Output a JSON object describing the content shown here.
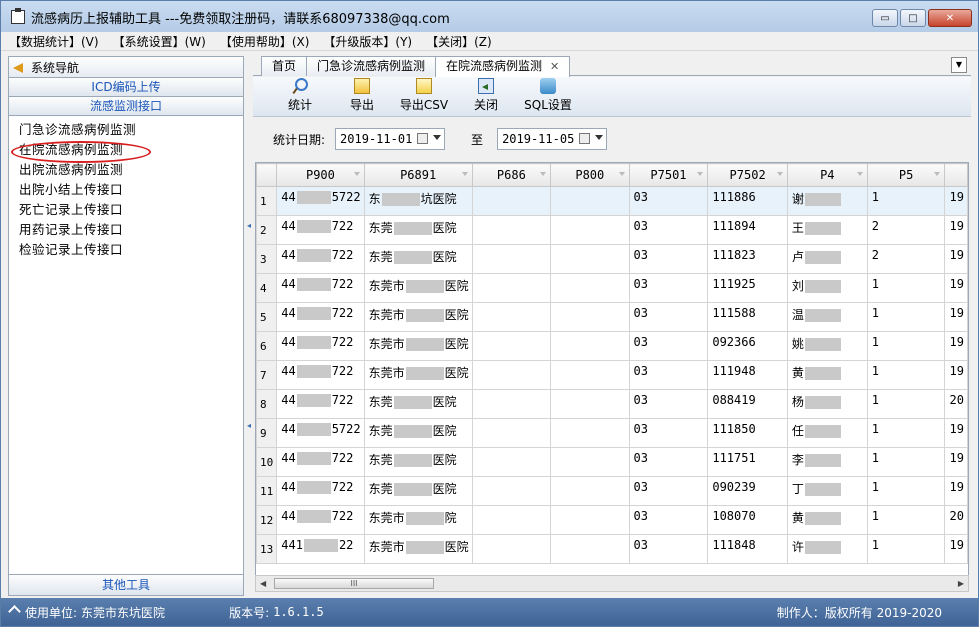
{
  "window": {
    "title": "流感病历上报辅助工具 ---免费领取注册码，请联系68097338@qq.com",
    "buttons": {
      "minimize": "▭",
      "maximize": "□",
      "close": "✕"
    }
  },
  "menu": [
    "【数据统计】(V)",
    "【系统设置】(W)",
    "【使用帮助】(X)",
    "【升级版本】(Y)",
    "【关闭】(Z)"
  ],
  "sidebar": {
    "header": "系统导航",
    "tabs": [
      "ICD编码上传",
      "流感监测接口"
    ],
    "items": [
      "门急诊流感病例监测",
      "在院流感病例监测",
      "出院流感病例监测",
      "出院小结上传接口",
      "死亡记录上传接口",
      "用药记录上传接口",
      "检验记录上传接口"
    ],
    "bottom_tab": "其他工具",
    "highlighted_item": "在院流感病例监测"
  },
  "tabs": [
    {
      "label": "首页"
    },
    {
      "label": "门急诊流感病例监测"
    },
    {
      "label": "在院流感病例监测",
      "close": "✕",
      "active": true
    }
  ],
  "toolbar": [
    {
      "label": "统计",
      "icon": "search-icon"
    },
    {
      "label": "导出",
      "icon": "export-icon"
    },
    {
      "label": "导出CSV",
      "icon": "export-csv-icon"
    },
    {
      "label": "关闭",
      "icon": "exit-icon"
    },
    {
      "label": "SQL设置",
      "icon": "sql-settings-icon"
    }
  ],
  "filter": {
    "label": "统计日期:",
    "start_date": "2019-11-01",
    "to_label": "至",
    "end_date": "2019-11-05"
  },
  "grid": {
    "columns": [
      "P900",
      "P6891",
      "P686",
      "P800",
      "P7501",
      "P7502",
      "P4",
      "P5"
    ],
    "rows": [
      {
        "n": "1",
        "p900": "44",
        "p900b": "5722",
        "p6891a": "东",
        "p6891b": "坑医院",
        "p7501": "03",
        "p7502": "111886",
        "p4": "谢",
        "p5": "1",
        "tail": "19"
      },
      {
        "n": "2",
        "p900": "44",
        "p900b": "722",
        "p6891a": "东莞",
        "p6891b": "医院",
        "p7501": "03",
        "p7502": "111894",
        "p4": "王",
        "p5": "2",
        "tail": "19"
      },
      {
        "n": "3",
        "p900": "44",
        "p900b": "722",
        "p6891a": "东莞",
        "p6891b": "医院",
        "p7501": "03",
        "p7502": "111823",
        "p4": "卢",
        "p5": "2",
        "tail": "19"
      },
      {
        "n": "4",
        "p900": "44",
        "p900b": "722",
        "p6891a": "东莞市",
        "p6891b": "医院",
        "p7501": "03",
        "p7502": "111925",
        "p4": "刘",
        "p5": "1",
        "tail": "19"
      },
      {
        "n": "5",
        "p900": "44",
        "p900b": "722",
        "p6891a": "东莞市",
        "p6891b": "医院",
        "p7501": "03",
        "p7502": "111588",
        "p4": "温",
        "p5": "1",
        "tail": "19"
      },
      {
        "n": "6",
        "p900": "44",
        "p900b": "722",
        "p6891a": "东莞市",
        "p6891b": "医院",
        "p7501": "03",
        "p7502": "092366",
        "p4": "姚",
        "p5": "1",
        "tail": "19"
      },
      {
        "n": "7",
        "p900": "44",
        "p900b": "722",
        "p6891a": "东莞市",
        "p6891b": "医院",
        "p7501": "03",
        "p7502": "111948",
        "p4": "黄",
        "p5": "1",
        "tail": "19"
      },
      {
        "n": "8",
        "p900": "44",
        "p900b": "722",
        "p6891a": "东莞",
        "p6891b": "医院",
        "p7501": "03",
        "p7502": "088419",
        "p4": "杨",
        "p5": "1",
        "tail": "20"
      },
      {
        "n": "9",
        "p900": "44",
        "p900b": "5722",
        "p6891a": "东莞",
        "p6891b": "医院",
        "p7501": "03",
        "p7502": "111850",
        "p4": "任",
        "p5": "1",
        "tail": "19"
      },
      {
        "n": "10",
        "p900": "44",
        "p900b": "722",
        "p6891a": "东莞",
        "p6891b": "医院",
        "p7501": "03",
        "p7502": "111751",
        "p4": "李",
        "p5": "1",
        "tail": "19"
      },
      {
        "n": "11",
        "p900": "44",
        "p900b": "722",
        "p6891a": "东莞",
        "p6891b": "医院",
        "p7501": "03",
        "p7502": "090239",
        "p4": "丁",
        "p5": "1",
        "tail": "19"
      },
      {
        "n": "12",
        "p900": "44",
        "p900b": "722",
        "p6891a": "东莞市",
        "p6891b": "院",
        "p7501": "03",
        "p7502": "108070",
        "p4": "黄",
        "p5": "1",
        "tail": "20"
      },
      {
        "n": "13",
        "p900": "441",
        "p900b": "22",
        "p6891a": "东莞市",
        "p6891b": "医院",
        "p7501": "03",
        "p7502": "111848",
        "p4": "许",
        "p5": "1",
        "tail": "19"
      }
    ],
    "scroll_thumb": "III"
  },
  "status": {
    "unit_label": "使用单位:",
    "unit_value": "东莞市东坑医院",
    "version_label": "版本号:",
    "version_value": "1.6.1.5",
    "copyright": "制作人：版权所有 2019-2020"
  },
  "colors": {
    "accent": "#1a55b8",
    "status_bg": "#4a6fa0",
    "highlight": "#d81e1e"
  }
}
